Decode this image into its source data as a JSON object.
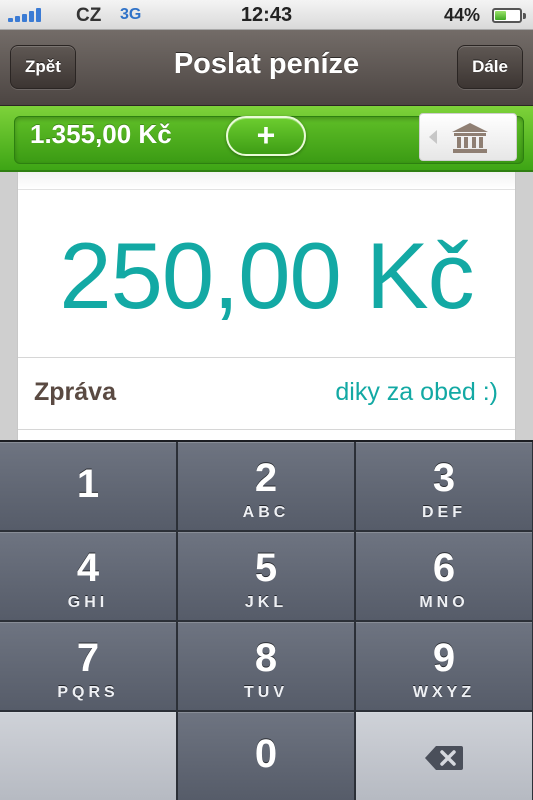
{
  "status_bar": {
    "carrier": "CZ",
    "network": "3G",
    "time": "12:43",
    "battery_percent": "44%",
    "battery_level": 0.44,
    "signal_bars": 5,
    "accent": "#3b7bd4"
  },
  "nav": {
    "back_label": "Zpět",
    "title": "Poslat peníze",
    "next_label": "Dále"
  },
  "balance": {
    "amount": "1.355,00 Kč",
    "add_symbol": "+",
    "bank_icon": "bank-icon",
    "color": "#3ea515"
  },
  "transfer": {
    "amount": "250,00 Kč",
    "amount_color": "#13a9a4",
    "message_label": "Zpráva",
    "message_value": "diky za obed :)"
  },
  "keypad": {
    "keys": [
      {
        "num": "1",
        "letters": ""
      },
      {
        "num": "2",
        "letters": "ABC"
      },
      {
        "num": "3",
        "letters": "DEF"
      },
      {
        "num": "4",
        "letters": "GHI"
      },
      {
        "num": "5",
        "letters": "JKL"
      },
      {
        "num": "6",
        "letters": "MNO"
      },
      {
        "num": "7",
        "letters": "PQRS"
      },
      {
        "num": "8",
        "letters": "TUV"
      },
      {
        "num": "9",
        "letters": "WXYZ"
      },
      {
        "num": "0",
        "letters": ""
      }
    ],
    "delete_icon": "backspace-icon"
  }
}
